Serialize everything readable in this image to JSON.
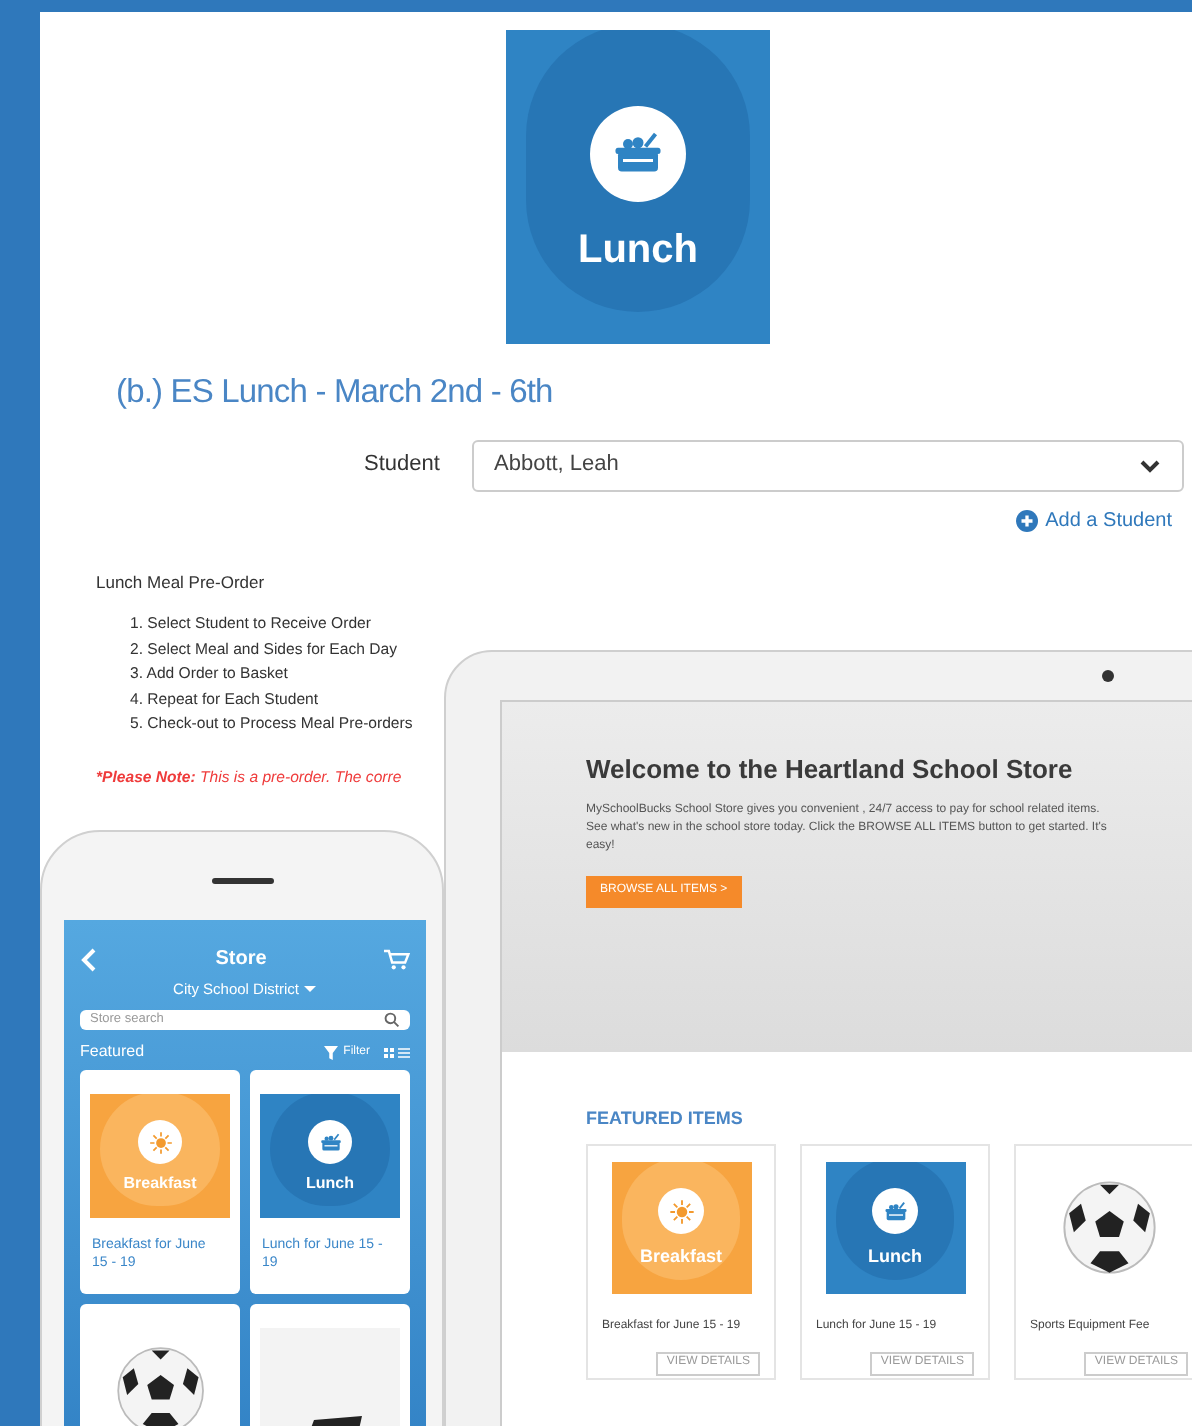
{
  "lunch_tile": {
    "kind": "lunch",
    "label": "Lunch"
  },
  "title": "(b.) ES Lunch - March 2nd - 6th",
  "student_field": {
    "label": "Student",
    "value": "Abbott, Leah"
  },
  "add_student": "Add a Student",
  "preorder": {
    "heading": "Lunch Meal Pre-Order",
    "steps": [
      "1. Select Student to Receive Order",
      "2. Select Meal and Sides for Each Day",
      "3. Add Order to Basket",
      "4. Repeat for Each Student",
      "5. Check-out to Process Meal Pre-orders"
    ],
    "note_label": "*Please Note:",
    "note_text": "This is a pre-order. The corre"
  },
  "tablet": {
    "hero": {
      "title": "Welcome to the Heartland School Store",
      "text": "MySchoolBucks School Store gives you convenient , 24/7 access to pay for school related items.  See what's new in the school store today.  Click the BROWSE ALL ITEMS button to get started.  It's easy!",
      "button": "BROWSE ALL ITEMS >"
    },
    "featured": {
      "heading": "FEATURED ITEMS",
      "items": [
        {
          "kind": "breakfast",
          "tile_label": "Breakfast",
          "name": "Breakfast for June 15 - 19",
          "button": "VIEW DETAILS"
        },
        {
          "kind": "lunch",
          "tile_label": "Lunch",
          "name": "Lunch for June 15 - 19",
          "button": "VIEW DETAILS"
        },
        {
          "kind": "ball",
          "name": "Sports Equipment Fee",
          "button": "VIEW DETAILS"
        }
      ]
    }
  },
  "phone": {
    "title": "Store",
    "district": "City School District",
    "search_placeholder": "Store search",
    "featured": "Featured",
    "filter": "Filter",
    "cards": [
      {
        "kind": "breakfast",
        "tile_label": "Breakfast",
        "name": "Breakfast for June 15 - 19"
      },
      {
        "kind": "lunch",
        "tile_label": "Lunch",
        "name": "Lunch for June 15 - 19"
      },
      {
        "kind": "ball"
      },
      {
        "kind": "dark_item"
      }
    ]
  }
}
